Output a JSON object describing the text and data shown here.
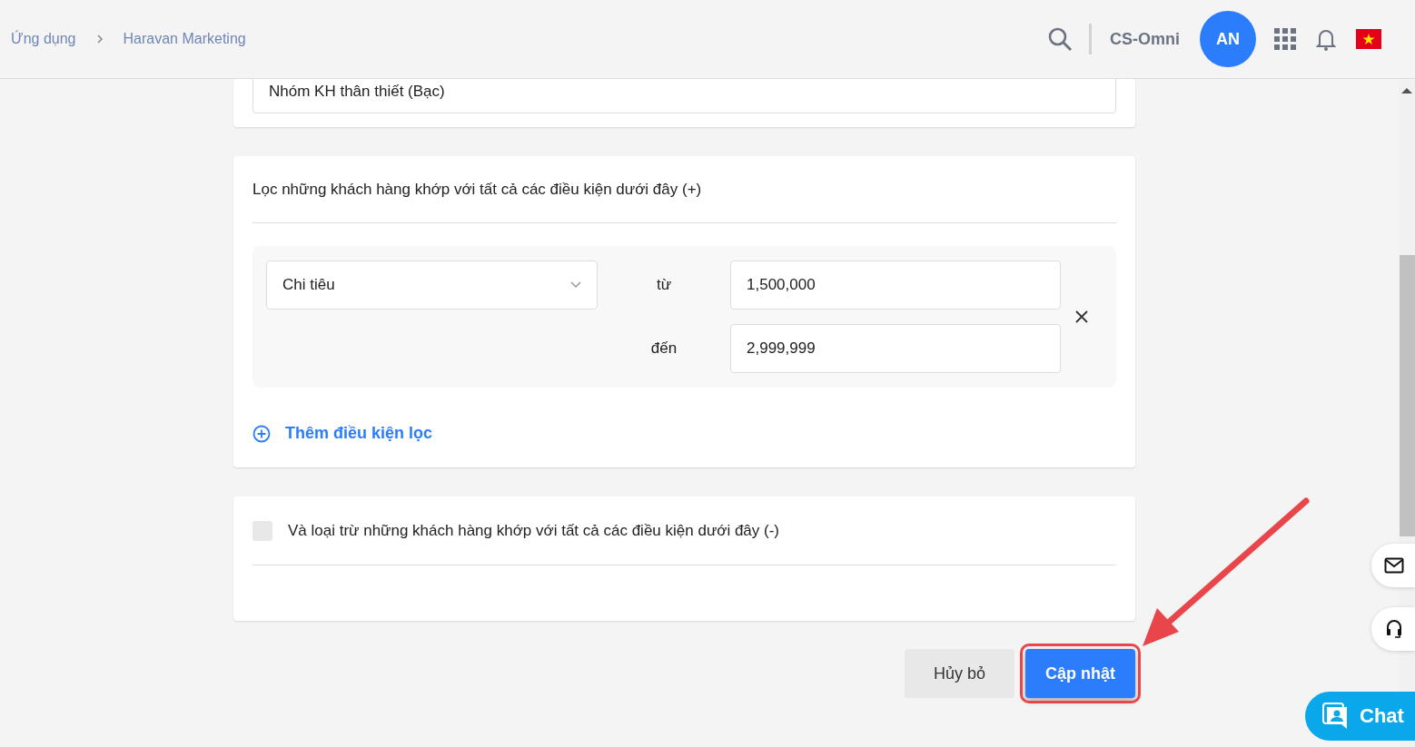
{
  "breadcrumb": [
    "Ứng dụng",
    "Haravan Marketing"
  ],
  "header": {
    "store": "CS-Omni",
    "avatar": "AN"
  },
  "group_field": {
    "value": "Nhóm KH thân thiết (Bạc)"
  },
  "include_section": {
    "title": "Lọc những khách hàng khớp với tất cả các điều kiện dưới đây (+)",
    "conditions": [
      {
        "field": "Chi tiêu",
        "from_label": "từ",
        "from_value": "1,500,000",
        "to_label": "đến",
        "to_value": "2,999,999"
      }
    ],
    "add_link": "Thêm điều kiện lọc"
  },
  "exclude_section": {
    "checked": false,
    "title": "Và loại trừ những khách hàng khớp với tất cả các điều kiện dưới đây (-)"
  },
  "buttons": [
    {
      "label": "Hủy bỏ",
      "kind": "secondary"
    },
    {
      "label": "Cập nhật",
      "kind": "primary",
      "highlighted": true
    }
  ],
  "chat": {
    "label": "Chat"
  }
}
